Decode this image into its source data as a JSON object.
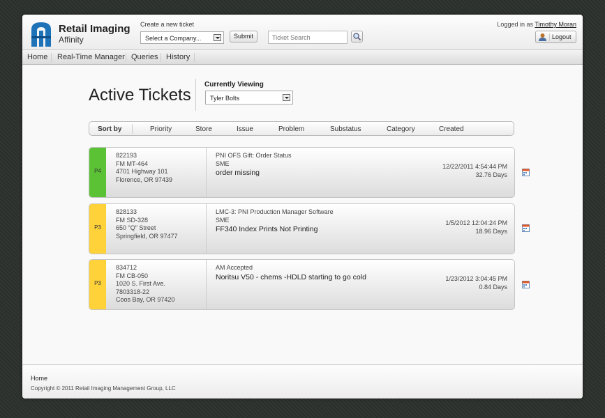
{
  "header": {
    "app_name": "Retail Imaging",
    "app_sub": "Affinity",
    "create_label": "Create a new ticket",
    "company_select": "Select a Company...",
    "submit_label": "Submit",
    "search_placeholder": "Ticket Search",
    "logged_in_prefix": "Logged in as",
    "user_name": "Timothy Moran",
    "logout_label": "Logout"
  },
  "nav": {
    "items": [
      "Home",
      "Real-Time Manager",
      "Queries",
      "History"
    ]
  },
  "main": {
    "title": "Active Tickets",
    "currently_viewing_label": "Currently Viewing",
    "viewing_value": "Tyler Bolts",
    "sort_label": "Sort by",
    "sort_options": [
      "Priority",
      "Store",
      "Issue",
      "Problem",
      "Substatus",
      "Category",
      "Created"
    ]
  },
  "tickets": [
    {
      "priority": "P4",
      "color": "#5bc236",
      "id": "822193",
      "store": "FM MT-464",
      "address1": "4701 Highway 101",
      "address2": "Florence, OR 97439",
      "address3": "",
      "category": "PNI OFS Gift: Order Status",
      "substatus": "SME",
      "description": "order missing",
      "created": "12/22/2011 4:54:44 PM",
      "age": "32.76 Days"
    },
    {
      "priority": "P3",
      "color": "#ffd23a",
      "id": "828133",
      "store": "FM SD-328",
      "address1": "650 \"Q\" Street",
      "address2": "Springfield, OR 97477",
      "address3": "",
      "category": "LMC-3: PNI Production Manager Software",
      "substatus": "SME",
      "description": "FF340 Index Prints Not Printing",
      "created": "1/5/2012 12:04:24 PM",
      "age": "18.96 Days"
    },
    {
      "priority": "P3",
      "color": "#ffd23a",
      "id": "834712",
      "store": "FM CB-050",
      "address1": "1020 S. First Ave.",
      "address2": "7803318-22",
      "address3": "Coos Bay, OR 97420",
      "category": "AM Accepted",
      "substatus": "",
      "description": "Noritsu V50 - chems -HDLD starting to go cold",
      "created": "1/23/2012 3:04:45 PM",
      "age": "0.84 Days"
    }
  ],
  "footer": {
    "home": "Home",
    "copyright": "Copyright © 2011 Retail Imaging Management Group, LLC"
  },
  "icons": {
    "logo": "logo-icon",
    "search": "search-icon",
    "user": "user-icon",
    "dropdown": "chevron-down-icon",
    "ticket_action": "calendar-icon"
  },
  "colors": {
    "brand_blue": "#1e73b8",
    "priority_p4": "#5bc236",
    "priority_p3": "#ffd23a"
  }
}
